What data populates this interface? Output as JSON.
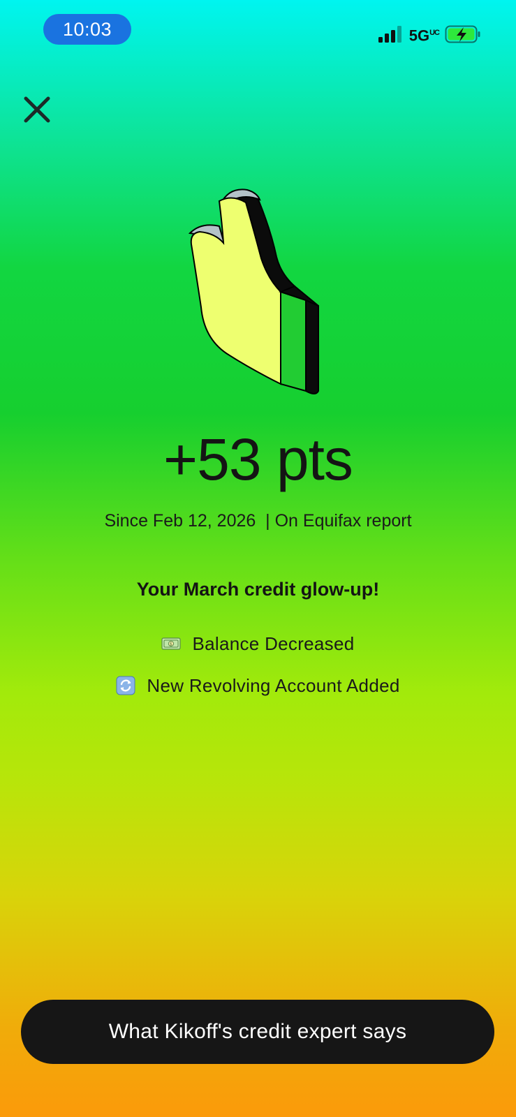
{
  "status_bar": {
    "time": "10:03",
    "network": "5G",
    "network_superscript": "UC",
    "signal_icon": "signal-bars-icon",
    "battery_icon": "battery-charging-icon"
  },
  "close": {
    "icon": "close-icon"
  },
  "hero": {
    "icon": "thumbs-up-icon"
  },
  "score": {
    "value": "+53 pts",
    "subtitle": "Since Feb 12, 2026  | On Equifax report"
  },
  "headline": "Your March credit glow-up!",
  "factors": [
    {
      "icon": "money-bill-icon",
      "label": "Balance Decreased"
    },
    {
      "icon": "refresh-arrows-icon",
      "label": "New Revolving Account Added"
    }
  ],
  "cta": {
    "label": "What Kikoff's credit expert says"
  },
  "colors": {
    "gradient_top": "#00f5f0",
    "gradient_middle": "#16cf2f",
    "gradient_bottom": "#fb9a0a",
    "time_pill": "#1a73e0",
    "cta_background": "#161616",
    "thumb_face": "#eeff70",
    "thumb_cuff": "#22cc33"
  }
}
